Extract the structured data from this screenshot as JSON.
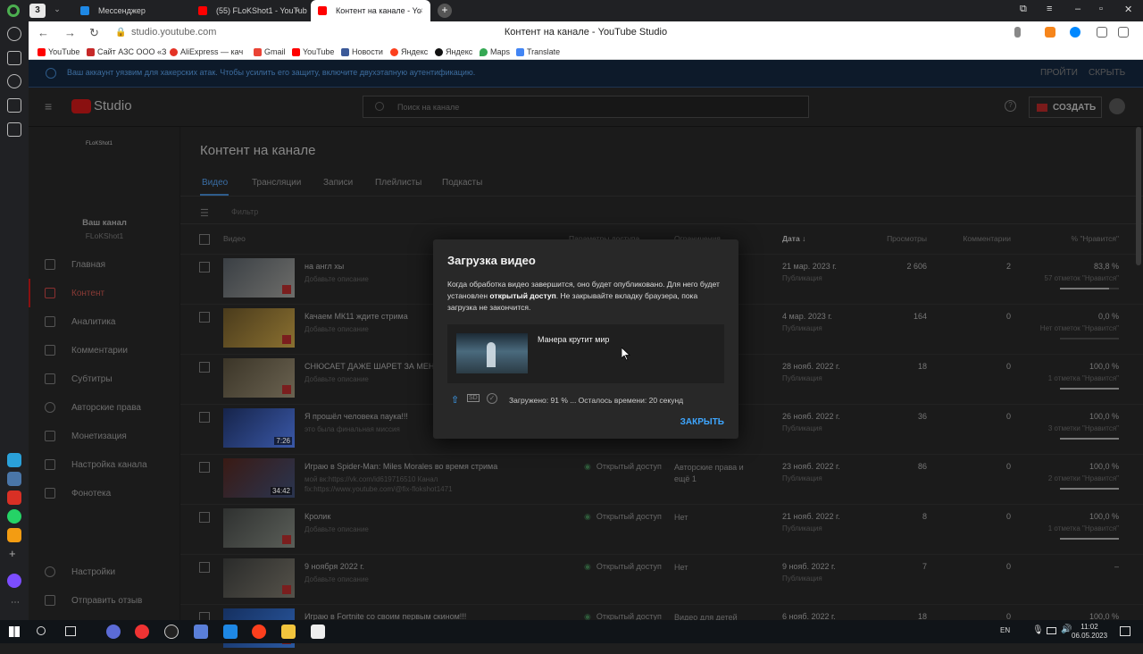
{
  "browser": {
    "tabs": [
      {
        "label": "3",
        "kind": "counter"
      },
      {
        "label": "Мессенджер"
      },
      {
        "label": "(55) FLoKShot1 - YouTube"
      },
      {
        "label": "Контент на канале - YouTube Studio",
        "display": "Контент на канале - Yo"
      }
    ],
    "url": "studio.youtube.com",
    "page_title": "Контент на канале - YouTube Studio",
    "bookmarks": [
      "YouTube",
      "Сайт АЗС ООО «З",
      "AliExpress — кач",
      "Gmail",
      "YouTube",
      "Новости",
      "Яндекс",
      "Яндекс",
      "Maps",
      "Translate"
    ]
  },
  "warning": {
    "message": "Ваш аккаунт уязвим для хакерских атак. Чтобы усилить его защиту, включите двухэтапную аутентификацию.",
    "action1": "ПРОЙТИ",
    "action2": "СКРЫТЬ"
  },
  "studio": {
    "logo": "Studio",
    "search_placeholder": "Поиск на канале",
    "create_label": "СОЗДАТЬ"
  },
  "channel": {
    "avatar_text": "FLoKShot1",
    "your_channel": "Ваш канал",
    "name": "FLoKShot1"
  },
  "sidebar": {
    "items": [
      {
        "label": "Главная"
      },
      {
        "label": "Контент"
      },
      {
        "label": "Аналитика"
      },
      {
        "label": "Комментарии"
      },
      {
        "label": "Субтитры"
      },
      {
        "label": "Авторские права"
      },
      {
        "label": "Монетизация"
      },
      {
        "label": "Настройка канала"
      },
      {
        "label": "Фонотека"
      }
    ],
    "settings": "Настройки",
    "feedback": "Отправить отзыв"
  },
  "content": {
    "title": "Контент на канале",
    "tabs": [
      "Видео",
      "Трансляции",
      "Записи",
      "Плейлисты",
      "Подкасты"
    ],
    "filter": "Фильтр",
    "columns": {
      "video": "Видео",
      "access": "Параметры доступа",
      "limits": "Ограничения",
      "date": "Дата",
      "views": "Просмотры",
      "comments": "Комментарии",
      "likes": "% \"Нравится\""
    },
    "rows": [
      {
        "title": "на англ хы",
        "desc": "Добавьте описание",
        "visibility": "",
        "limits": "",
        "date": "21 мар. 2023 г.",
        "status": "Публикация",
        "views": "2 606",
        "comments": "2",
        "likes": "83,8 %",
        "likes_sub": "57 отметок \"Нравится\"",
        "like_ratio": 0.838,
        "duration": ""
      },
      {
        "title": "Качаем МК11 ждите стрима",
        "desc": "Добавьте описание",
        "visibility": "",
        "limits": "",
        "date": "4 мар. 2023 г.",
        "status": "Публикация",
        "views": "164",
        "comments": "0",
        "likes": "0,0 %",
        "likes_sub": "Нет отметок \"Нравится\"",
        "like_ratio": 0.0,
        "duration": ""
      },
      {
        "title": "СНЮСАЕТ ДАЖЕ ШАРЕТ ЗА МЕНЯ",
        "desc": "Добавьте описание",
        "visibility": "",
        "limits": "",
        "date": "28 нояб. 2022 г.",
        "status": "Публикация",
        "views": "18",
        "comments": "0",
        "likes": "100,0 %",
        "likes_sub": "1 отметка \"Нравится\"",
        "like_ratio": 1.0,
        "duration": ""
      },
      {
        "title": "Я прошёл человека паука!!!",
        "desc": "это была финальная миссия",
        "visibility": "",
        "limits": "",
        "date": "26 нояб. 2022 г.",
        "status": "Публикация",
        "views": "36",
        "comments": "0",
        "likes": "100,0 %",
        "likes_sub": "3 отметки \"Нравится\"",
        "like_ratio": 1.0,
        "duration": "7:26"
      },
      {
        "title": "Играю в Spider-Man: Miles Morales во время стрима",
        "desc": "мой вк:https://vk.com/id619716510 Канал fix:https://www.youtube.com/@fix-flokshot1471",
        "visibility": "Открытый доступ",
        "limits": "Авторские права и ещё 1",
        "date": "23 нояб. 2022 г.",
        "status": "Публикация",
        "views": "86",
        "comments": "0",
        "likes": "100,0 %",
        "likes_sub": "2 отметки \"Нравится\"",
        "like_ratio": 1.0,
        "duration": "34:42"
      },
      {
        "title": "Кролик",
        "desc": "Добавьте описание",
        "visibility": "Открытый доступ",
        "limits": "Нет",
        "date": "21 нояб. 2022 г.",
        "status": "Публикация",
        "views": "8",
        "comments": "0",
        "likes": "100,0 %",
        "likes_sub": "1 отметка \"Нравится\"",
        "like_ratio": 1.0,
        "duration": ""
      },
      {
        "title": "9 ноября 2022 г.",
        "desc": "Добавьте описание",
        "visibility": "Открытый доступ",
        "limits": "Нет",
        "date": "9 нояб. 2022 г.",
        "status": "Публикация",
        "views": "7",
        "comments": "0",
        "likes": "–",
        "likes_sub": "",
        "like_ratio": null,
        "duration": ""
      },
      {
        "title": "Играю в Fortnite со своим первым скином!!!",
        "desc": "",
        "visibility": "Открытый доступ",
        "limits": "Видео для детей",
        "date": "6 нояб. 2022 г.",
        "status": "",
        "views": "18",
        "comments": "0",
        "likes": "100,0 %",
        "likes_sub": "",
        "like_ratio": 1.0,
        "duration": ""
      }
    ]
  },
  "dialog": {
    "title": "Загрузка видео",
    "text1": "Когда обработка видео завершится, оно будет опубликовано. Для него будет установлен ",
    "text_bold": "открытый доступ",
    "text2": ". Не закрывайте вкладку браузера, пока загрузка не закончится.",
    "video_title": "Манера крутит мир",
    "sd_badge": "SD",
    "status": "Загружено: 91 % ... Осталось времени: 20 секунд",
    "progress": 0.91,
    "close": "ЗАКРЫТЬ"
  },
  "taskbar": {
    "lang": "EN",
    "time": "11:02",
    "date": "06.05.2023"
  },
  "colors": {
    "accent_blue": "#3ea6ff",
    "brand_red": "#ff0000",
    "dark_bg": "#1b1b1b"
  }
}
